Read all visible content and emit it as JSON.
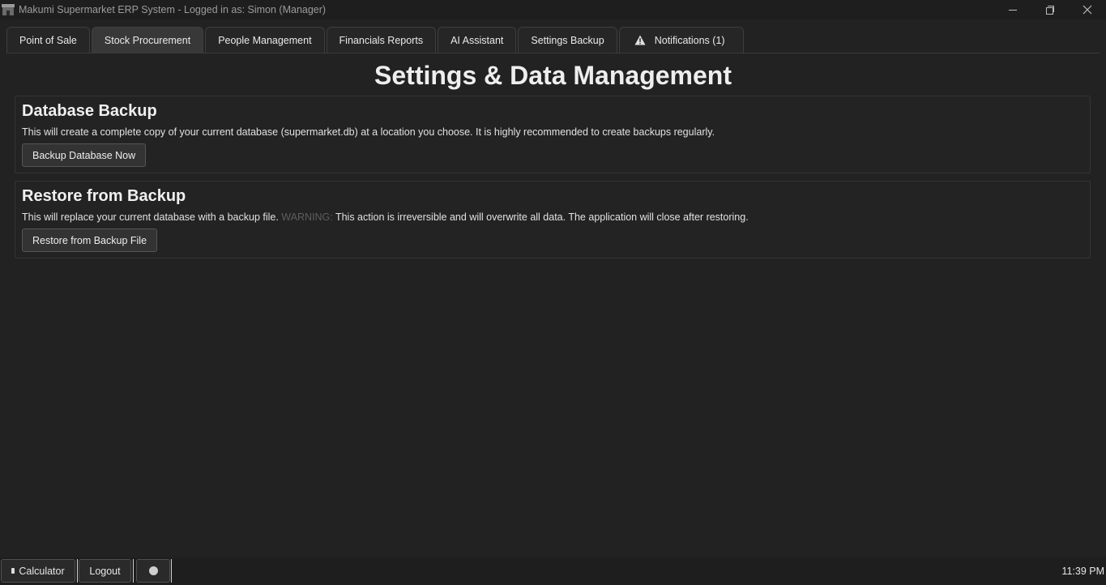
{
  "window": {
    "title": "Makumi Supermarket ERP System - Logged in as: Simon (Manager)"
  },
  "tabs": [
    {
      "label": "Point of Sale"
    },
    {
      "label": "Stock  Procurement"
    },
    {
      "label": "People Management"
    },
    {
      "label": "Financials  Reports"
    },
    {
      "label": "AI Assistant"
    },
    {
      "label": "Settings  Backup"
    },
    {
      "label": "Notifications (1)",
      "icon": "warning-icon"
    }
  ],
  "page": {
    "title": "Settings & Data Management"
  },
  "backup": {
    "title": "Database Backup",
    "description": "This will create a complete copy of your current database (supermarket.db) at a location you choose. It is highly recommended to create backups regularly.",
    "button": "Backup Database Now"
  },
  "restore": {
    "title": "Restore from Backup",
    "description_prefix": "This will replace your current database with a backup file. ",
    "warning_word": "WARNING:",
    "description_suffix": " This action is irreversible and will overwrite all data. The application will close after restoring.",
    "button": "Restore from Backup File"
  },
  "statusbar": {
    "calculator": "Calculator",
    "logout": "Logout",
    "theme_icon": "theme-toggle-icon",
    "clock": "11:39 PM"
  },
  "colors": {
    "background": "#222222",
    "titlebar": "#1e1e1e",
    "tab_selected": "#383838",
    "warning_text": "#5e5e5e"
  }
}
